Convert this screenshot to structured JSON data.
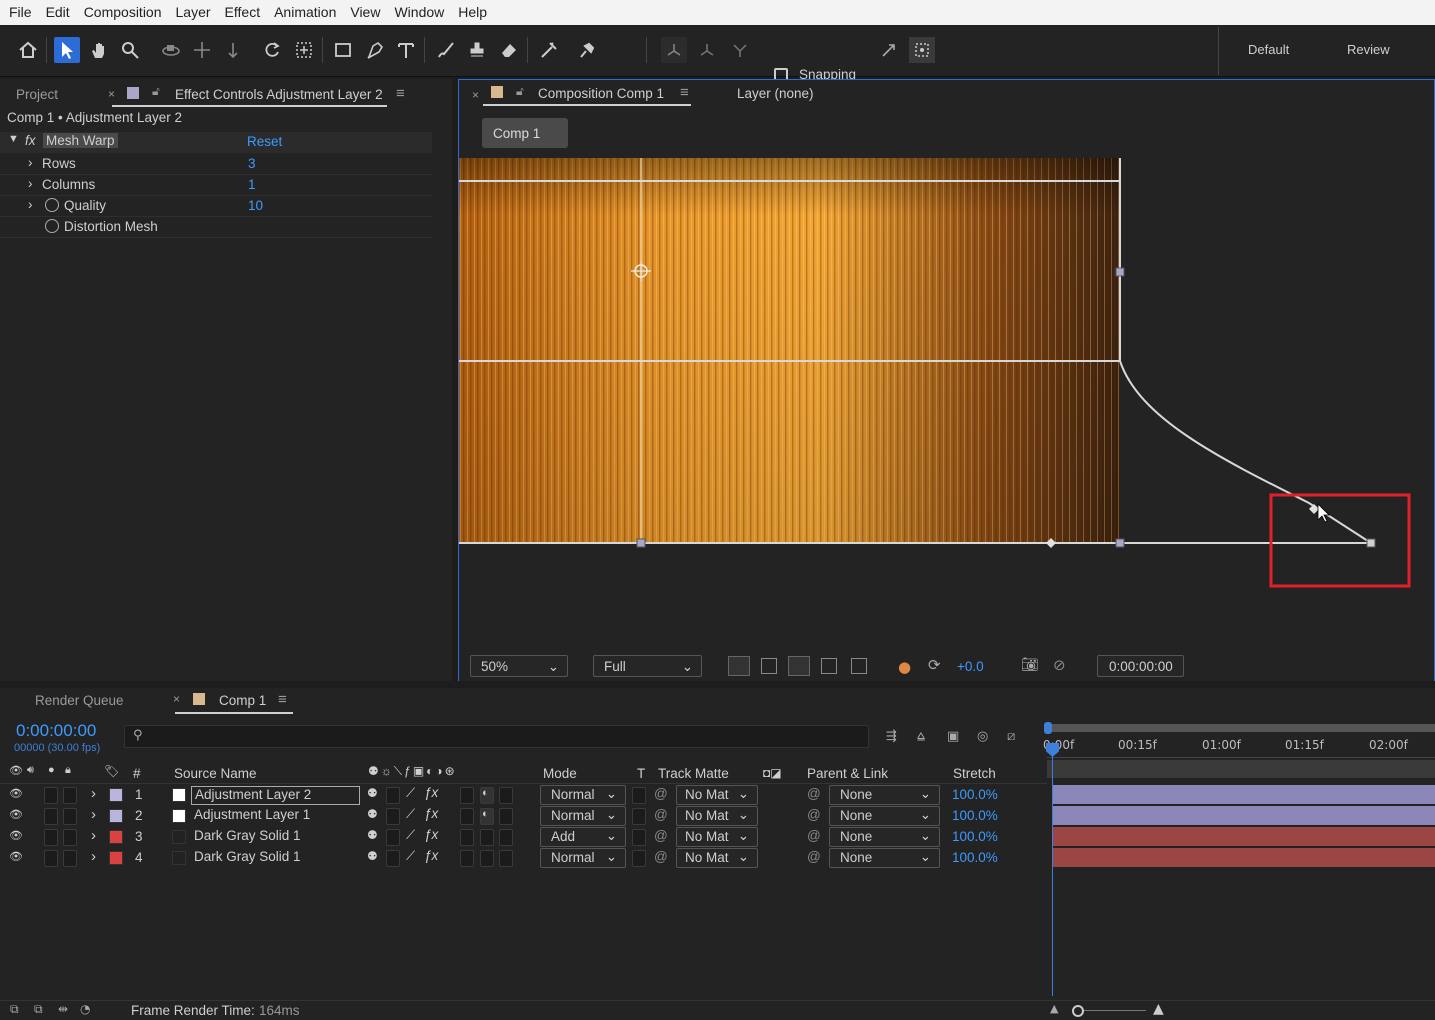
{
  "menu": [
    "File",
    "Edit",
    "Composition",
    "Layer",
    "Effect",
    "Animation",
    "View",
    "Window",
    "Help"
  ],
  "toolbar": {
    "snapping_label": "Snapping",
    "workspaces": [
      "Default",
      "Review"
    ]
  },
  "effect_panel": {
    "tab_project": "Project",
    "tab_effect": "Effect Controls Adjustment Layer 2",
    "breadcrumb": "Comp 1 • Adjustment Layer 2",
    "effect_name": "Mesh Warp",
    "reset_label": "Reset",
    "fx_label": "fx",
    "params": [
      {
        "name": "Rows",
        "value": "3"
      },
      {
        "name": "Columns",
        "value": "1"
      },
      {
        "name": "Quality",
        "value": "10"
      },
      {
        "name": "Distortion Mesh",
        "value": ""
      }
    ]
  },
  "comp_panel": {
    "tab_comp": "Composition Comp 1",
    "tab_layer": "Layer (none)",
    "comp_button": "Comp 1",
    "zoom": "50%",
    "resolution": "Full",
    "exposure": "+0.0",
    "timecode": "0:00:00:00"
  },
  "timeline": {
    "tab_render": "Render Queue",
    "tab_comp": "Comp 1",
    "current_time": "0:00:00:00",
    "fps_label": "00000 (30.00 fps)",
    "search_placeholder": "",
    "col_num": "#",
    "col_source": "Source Name",
    "col_mode": "Mode",
    "col_t": "T",
    "col_track": "Track Matte",
    "col_parent": "Parent & Link",
    "col_stretch": "Stretch",
    "ruler": [
      "0:00f",
      "00:15f",
      "01:00f",
      "01:15f",
      "02:00f"
    ],
    "layers": [
      {
        "num": "1",
        "name": "Adjustment Layer 2",
        "mode": "Normal",
        "matte": "No Mat",
        "parent": "None",
        "stretch": "100.0%",
        "label_color": "#b8b4dc",
        "bar_color": "#8a87b8"
      },
      {
        "num": "2",
        "name": "Adjustment Layer 1",
        "mode": "Normal",
        "matte": "No Mat",
        "parent": "None",
        "stretch": "100.0%",
        "label_color": "#b8b4dc",
        "bar_color": "#8a87b8"
      },
      {
        "num": "3",
        "name": "Dark Gray Solid 1",
        "mode": "Add",
        "matte": "No Mat",
        "parent": "None",
        "stretch": "100.0%",
        "label_color": "#d9423e",
        "bar_color": "#9b4545"
      },
      {
        "num": "4",
        "name": "Dark Gray Solid 1",
        "mode": "Normal",
        "matte": "No Mat",
        "parent": "None",
        "stretch": "100.0%",
        "label_color": "#d9423e",
        "bar_color": "#9b4545"
      }
    ],
    "footer_label": "Frame Render Time:",
    "footer_value": "164ms"
  },
  "colors": {
    "accent": "#2d6cd6",
    "value_blue": "#3d9aff",
    "highlight_box": "#e0202a"
  }
}
